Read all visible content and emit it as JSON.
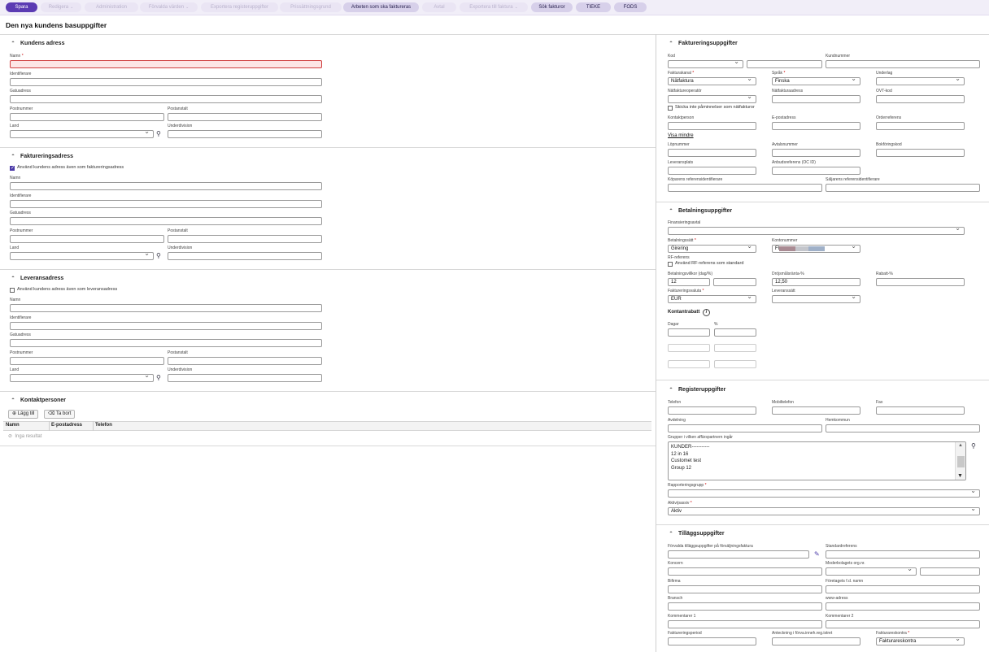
{
  "toolbar": {
    "save": "Spara",
    "edit": "Redigera",
    "admin": "Administration",
    "defaults": "Förvalda värden",
    "export_reg": "Exportera registeruppgifter",
    "pricing": "Prissättningsgrund",
    "work_invoice": "Arbeten som ska faktureras",
    "contract": "Avtal",
    "export_inv": "Exportera till faktura",
    "search_inv": "Sök fakturor",
    "tieke": "TIEKE",
    "fods": "FODS"
  },
  "page_title": "Den nya kundens basuppgifter",
  "customer_address": {
    "title": "Kundens adress",
    "name_label": "Namn",
    "identifier_label": "Identifierare",
    "street_label": "Gatuadress",
    "postcode_label": "Postnummer",
    "postoffice_label": "Postanstalt",
    "country_label": "Land",
    "subdivision_label": "Underdivision"
  },
  "billing_address": {
    "title": "Faktureringsadress",
    "use_customer": "Använd kundens adress även som faktureringsadress",
    "name_label": "Namn",
    "identifier_label": "Identifierare",
    "street_label": "Gatuadress",
    "postcode_label": "Postnummer",
    "postoffice_label": "Postanstalt",
    "country_label": "Land",
    "subdivision_label": "Underdivision"
  },
  "delivery_address": {
    "title": "Leveransadress",
    "use_customer": "Använd kundens adress även som leveransadress",
    "name_label": "Namn",
    "identifier_label": "Identifierare",
    "street_label": "Gatuadress",
    "postcode_label": "Postnummer",
    "postoffice_label": "Postanstalt",
    "country_label": "Land",
    "subdivision_label": "Underdivision"
  },
  "contacts": {
    "title": "Kontaktpersoner",
    "add": "Lägg till",
    "remove": "Ta bort",
    "columns": [
      "Namn",
      "E-postadress",
      "Telefon"
    ],
    "empty": "Inga resultat"
  },
  "billing_info": {
    "title": "Faktureringsuppgifter",
    "code": "Kod",
    "customer_no": "Kundnummer",
    "channel": "Fakturakanal",
    "channel_value": "Nätfaktura",
    "language": "Språk",
    "language_value": "Finska",
    "attachment": "Underlag",
    "operator": "Nätfaktureoperatör",
    "net_address": "Nätfakturaadress",
    "ovt": "OVT-kod",
    "no_reminders": "Skicka inte påminnelser som nätfakturor",
    "contact": "Kontaktperson",
    "email": "E-postadress",
    "order_ref": "Orderreferens",
    "show_less": "Visa mindre",
    "serial_no": "Löpnummer",
    "contract_no": "Avtalsnummer",
    "account_code": "Bokföringskod",
    "delivery_place": "Leveransplats",
    "offer_ref": "Anbudsreferens (OC ID)",
    "buyer_ref": "Köparens referensidentifierare",
    "seller_ref": "Säljarens referensidentifierare"
  },
  "payment_info": {
    "title": "Betalningsuppgifter",
    "financing": "Finansieringsavtal",
    "method": "Betalningssätt",
    "method_value": "Girering",
    "account": "Kontonummer",
    "account_prefix": "FI",
    "rf_ref": "RF-referens",
    "use_rf": "Använd RF-referens som standard",
    "terms": "Betalningsvillkor (dag/%)",
    "terms_value": "12",
    "late_interest": "Dröjsmålsränta-%",
    "late_interest_value": "12,50",
    "discount": "Rabatt-%",
    "currency": "Faktureringsvaluta",
    "currency_value": "EUR",
    "delivery_method": "Leveranssätt",
    "cash_discount": "Kontantrabatt",
    "days": "Dagar",
    "percent": "%"
  },
  "register_info": {
    "title": "Registeruppgifter",
    "phone": "Telefon",
    "mobile": "Mobiltelefon",
    "fax": "Fax",
    "department": "Avdelning",
    "home_municipality": "Hemkommun",
    "groups": "Grupper i vilken affärspartnern ingår",
    "group_items": [
      "KUNDER-----------",
      "12 in 16",
      "Customet test",
      "Group 12"
    ],
    "reporting_group": "Rapporteringsgrupp",
    "active": "Aktiv/passiv",
    "active_value": "Aktiv"
  },
  "additional_info": {
    "title": "Tilläggsuppgifter",
    "preset": "Förvalda tilläggsuppgifter på försäljningsfaktura",
    "std_ref": "Standardreferens",
    "concern": "Koncern",
    "parent_org": "Moderbolagets org.nr.",
    "side_firm": "Bifirma",
    "former_name": "Företagets f.d. namn",
    "branch": "Bransch",
    "www": "www-adress",
    "comment1": "Kommentarer 1",
    "comment2": "Kommentarer 2",
    "billing_period": "Faktureringsperiod",
    "trade_register": "Anteckning i förva.inneh.reg.istret",
    "ledger": "Fakturareskontra",
    "ledger_value": "Fakturareskontra"
  },
  "colors": {
    "primary": "#5b3bb3",
    "required_border": "#d04040",
    "masked1": "#a98b93",
    "masked2": "#9fb0c8"
  }
}
